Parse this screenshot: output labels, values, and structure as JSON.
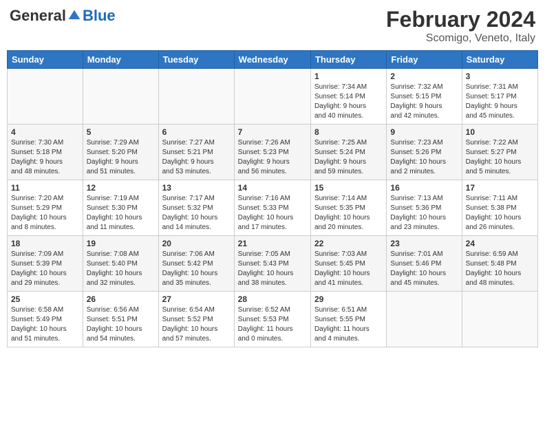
{
  "header": {
    "logo": {
      "general": "General",
      "blue": "Blue"
    },
    "title": "February 2024",
    "location": "Scomigo, Veneto, Italy"
  },
  "calendar": {
    "weekdays": [
      "Sunday",
      "Monday",
      "Tuesday",
      "Wednesday",
      "Thursday",
      "Friday",
      "Saturday"
    ],
    "weeks": [
      [
        {
          "day": "",
          "info": ""
        },
        {
          "day": "",
          "info": ""
        },
        {
          "day": "",
          "info": ""
        },
        {
          "day": "",
          "info": ""
        },
        {
          "day": "1",
          "info": "Sunrise: 7:34 AM\nSunset: 5:14 PM\nDaylight: 9 hours\nand 40 minutes."
        },
        {
          "day": "2",
          "info": "Sunrise: 7:32 AM\nSunset: 5:15 PM\nDaylight: 9 hours\nand 42 minutes."
        },
        {
          "day": "3",
          "info": "Sunrise: 7:31 AM\nSunset: 5:17 PM\nDaylight: 9 hours\nand 45 minutes."
        }
      ],
      [
        {
          "day": "4",
          "info": "Sunrise: 7:30 AM\nSunset: 5:18 PM\nDaylight: 9 hours\nand 48 minutes."
        },
        {
          "day": "5",
          "info": "Sunrise: 7:29 AM\nSunset: 5:20 PM\nDaylight: 9 hours\nand 51 minutes."
        },
        {
          "day": "6",
          "info": "Sunrise: 7:27 AM\nSunset: 5:21 PM\nDaylight: 9 hours\nand 53 minutes."
        },
        {
          "day": "7",
          "info": "Sunrise: 7:26 AM\nSunset: 5:23 PM\nDaylight: 9 hours\nand 56 minutes."
        },
        {
          "day": "8",
          "info": "Sunrise: 7:25 AM\nSunset: 5:24 PM\nDaylight: 9 hours\nand 59 minutes."
        },
        {
          "day": "9",
          "info": "Sunrise: 7:23 AM\nSunset: 5:26 PM\nDaylight: 10 hours\nand 2 minutes."
        },
        {
          "day": "10",
          "info": "Sunrise: 7:22 AM\nSunset: 5:27 PM\nDaylight: 10 hours\nand 5 minutes."
        }
      ],
      [
        {
          "day": "11",
          "info": "Sunrise: 7:20 AM\nSunset: 5:29 PM\nDaylight: 10 hours\nand 8 minutes."
        },
        {
          "day": "12",
          "info": "Sunrise: 7:19 AM\nSunset: 5:30 PM\nDaylight: 10 hours\nand 11 minutes."
        },
        {
          "day": "13",
          "info": "Sunrise: 7:17 AM\nSunset: 5:32 PM\nDaylight: 10 hours\nand 14 minutes."
        },
        {
          "day": "14",
          "info": "Sunrise: 7:16 AM\nSunset: 5:33 PM\nDaylight: 10 hours\nand 17 minutes."
        },
        {
          "day": "15",
          "info": "Sunrise: 7:14 AM\nSunset: 5:35 PM\nDaylight: 10 hours\nand 20 minutes."
        },
        {
          "day": "16",
          "info": "Sunrise: 7:13 AM\nSunset: 5:36 PM\nDaylight: 10 hours\nand 23 minutes."
        },
        {
          "day": "17",
          "info": "Sunrise: 7:11 AM\nSunset: 5:38 PM\nDaylight: 10 hours\nand 26 minutes."
        }
      ],
      [
        {
          "day": "18",
          "info": "Sunrise: 7:09 AM\nSunset: 5:39 PM\nDaylight: 10 hours\nand 29 minutes."
        },
        {
          "day": "19",
          "info": "Sunrise: 7:08 AM\nSunset: 5:40 PM\nDaylight: 10 hours\nand 32 minutes."
        },
        {
          "day": "20",
          "info": "Sunrise: 7:06 AM\nSunset: 5:42 PM\nDaylight: 10 hours\nand 35 minutes."
        },
        {
          "day": "21",
          "info": "Sunrise: 7:05 AM\nSunset: 5:43 PM\nDaylight: 10 hours\nand 38 minutes."
        },
        {
          "day": "22",
          "info": "Sunrise: 7:03 AM\nSunset: 5:45 PM\nDaylight: 10 hours\nand 41 minutes."
        },
        {
          "day": "23",
          "info": "Sunrise: 7:01 AM\nSunset: 5:46 PM\nDaylight: 10 hours\nand 45 minutes."
        },
        {
          "day": "24",
          "info": "Sunrise: 6:59 AM\nSunset: 5:48 PM\nDaylight: 10 hours\nand 48 minutes."
        }
      ],
      [
        {
          "day": "25",
          "info": "Sunrise: 6:58 AM\nSunset: 5:49 PM\nDaylight: 10 hours\nand 51 minutes."
        },
        {
          "day": "26",
          "info": "Sunrise: 6:56 AM\nSunset: 5:51 PM\nDaylight: 10 hours\nand 54 minutes."
        },
        {
          "day": "27",
          "info": "Sunrise: 6:54 AM\nSunset: 5:52 PM\nDaylight: 10 hours\nand 57 minutes."
        },
        {
          "day": "28",
          "info": "Sunrise: 6:52 AM\nSunset: 5:53 PM\nDaylight: 11 hours\nand 0 minutes."
        },
        {
          "day": "29",
          "info": "Sunrise: 6:51 AM\nSunset: 5:55 PM\nDaylight: 11 hours\nand 4 minutes."
        },
        {
          "day": "",
          "info": ""
        },
        {
          "day": "",
          "info": ""
        }
      ]
    ]
  }
}
